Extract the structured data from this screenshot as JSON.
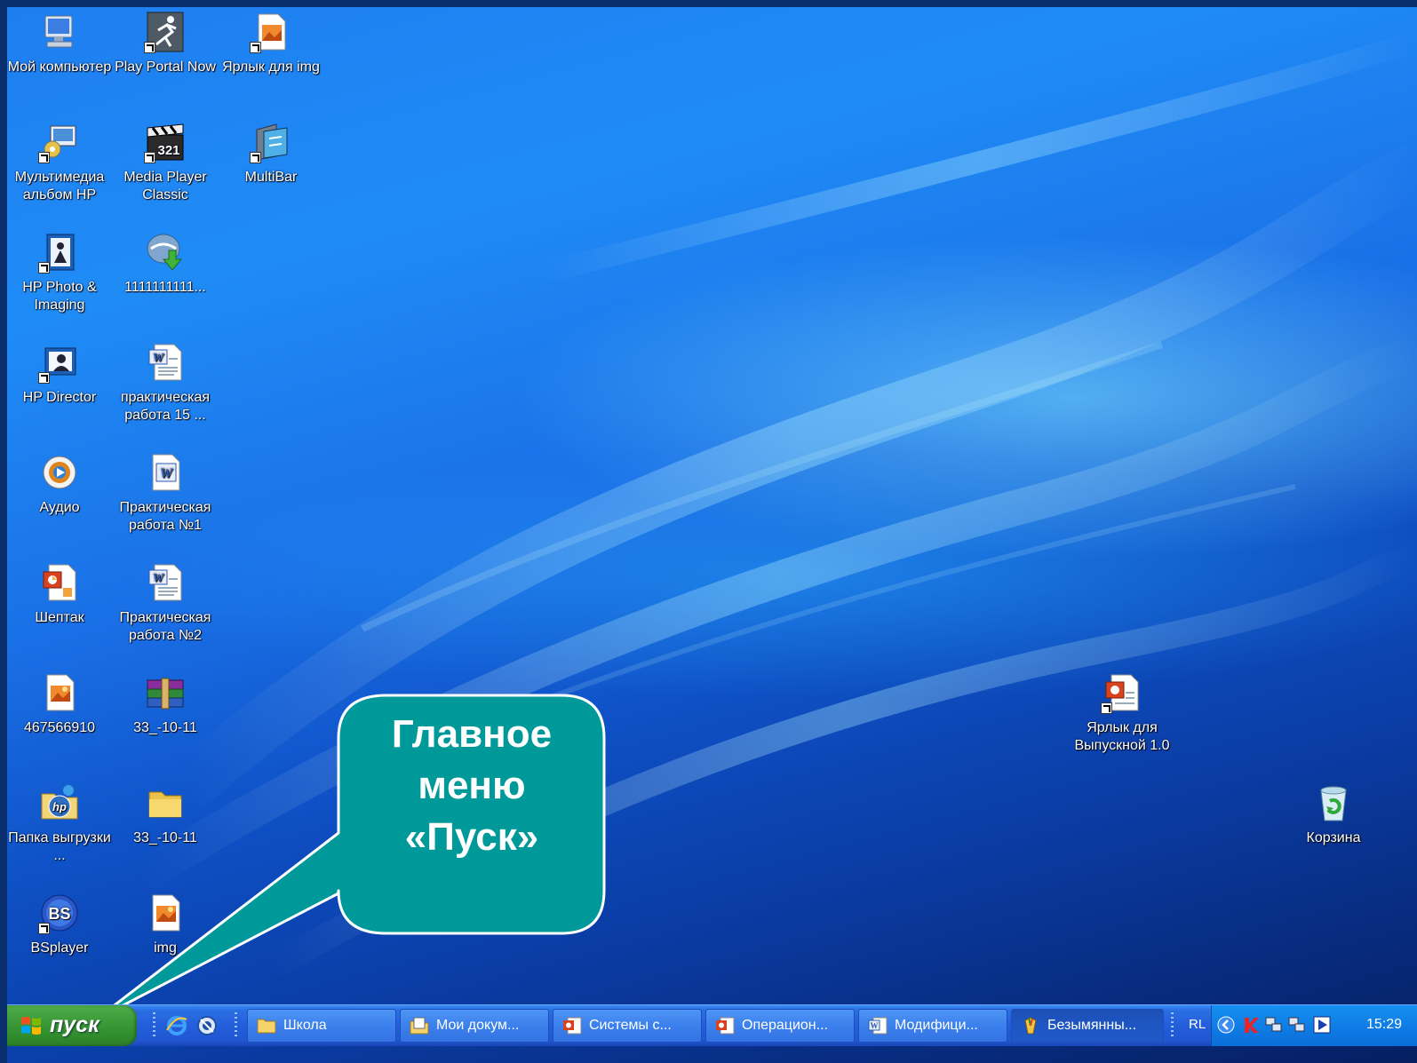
{
  "desktop": {
    "icons": [
      {
        "id": "my-computer",
        "label": "Мой компьютер",
        "icon": "computer-icon",
        "shortcut": false
      },
      {
        "id": "play-portal",
        "label": "Play Portal Now",
        "icon": "runner-icon",
        "shortcut": true
      },
      {
        "id": "img-shortcut",
        "label": "Ярлык для img",
        "icon": "image-file-icon",
        "shortcut": true
      },
      {
        "id": "hp-album",
        "label": "Мультимедиа альбом HP",
        "icon": "multimedia-icon",
        "shortcut": true
      },
      {
        "id": "media-player-classic",
        "label": "Media Player Classic",
        "icon": "clapperboard-icon",
        "shortcut": true
      },
      {
        "id": "multibar",
        "label": "MultiBar",
        "icon": "multibar-icon",
        "shortcut": true
      },
      {
        "id": "hp-photo",
        "label": "HP Photo & Imaging",
        "icon": "hp-photo-icon",
        "shortcut": true
      },
      {
        "id": "download-1111",
        "label": "1111111111...",
        "icon": "download-icon",
        "shortcut": false
      },
      {
        "id": "hp-director",
        "label": "HP Director",
        "icon": "hp-director-icon",
        "shortcut": true
      },
      {
        "id": "practical-15",
        "label": "практическая работа 15 ...",
        "icon": "word-doc-icon",
        "shortcut": false
      },
      {
        "id": "audio",
        "label": "Аудио",
        "icon": "media-disc-icon",
        "shortcut": false
      },
      {
        "id": "practical-1",
        "label": "Практическая работа №1",
        "icon": "word-doc-icon",
        "shortcut": false
      },
      {
        "id": "sheptak",
        "label": "Шептак",
        "icon": "powerpoint-icon",
        "shortcut": false
      },
      {
        "id": "practical-2",
        "label": "Практическая работа №2",
        "icon": "word-doc-icon",
        "shortcut": false
      },
      {
        "id": "file-467566910",
        "label": "467566910",
        "icon": "image-file-icon",
        "shortcut": false
      },
      {
        "id": "archive-33",
        "label": "33_-10-11",
        "icon": "winrar-archive-icon",
        "shortcut": false
      },
      {
        "id": "upload-folder",
        "label": "Папка выгрузки ...",
        "icon": "hp-folder-icon",
        "shortcut": false
      },
      {
        "id": "folder-33",
        "label": "33_-10-11",
        "icon": "folder-icon",
        "shortcut": false
      },
      {
        "id": "bsplayer",
        "label": "BSplayer",
        "icon": "bsplayer-icon",
        "shortcut": true
      },
      {
        "id": "img",
        "label": "img",
        "icon": "image-file-icon",
        "shortcut": false
      },
      {
        "id": "graduation-shortcut",
        "label": "Ярлык для Выпускной 1.0",
        "icon": "powerpoint-icon",
        "shortcut": true
      },
      {
        "id": "recycle-bin",
        "label": "Корзина",
        "icon": "recycle-bin-icon",
        "shortcut": false
      }
    ]
  },
  "callout": {
    "lines": [
      "Главное",
      "меню",
      "«Пуск»"
    ],
    "fill": "#009999",
    "stroke": "#ffffff"
  },
  "taskbar": {
    "start_label": "пуск",
    "quick_launch": [
      "ie-icon",
      "browser-icon"
    ],
    "buttons": [
      {
        "label": "Школа",
        "icon": "folder-icon",
        "active": false
      },
      {
        "label": "Мои докум...",
        "icon": "documents-icon",
        "active": false
      },
      {
        "label": "Системы с...",
        "icon": "powerpoint-icon",
        "active": false
      },
      {
        "label": "Операцион...",
        "icon": "powerpoint-icon",
        "active": false
      },
      {
        "label": "Модифици...",
        "icon": "word-doc-icon",
        "active": false
      },
      {
        "label": "Безымянны...",
        "icon": "paint-icon",
        "active": true
      }
    ],
    "tray": {
      "language": "RL",
      "icons": [
        "tray-chevron-icon",
        "kaspersky-icon",
        "network-icon",
        "network-icon-2",
        "media-play-icon"
      ],
      "clock": "15:29"
    }
  }
}
